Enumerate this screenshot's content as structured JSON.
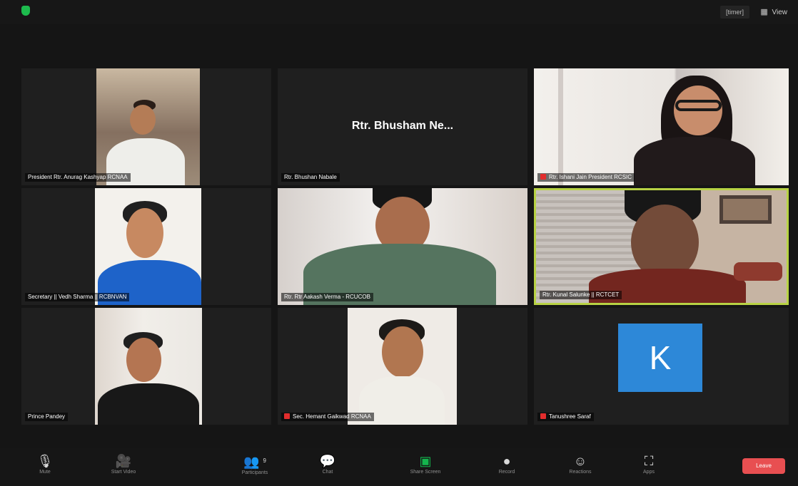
{
  "window": {
    "timer": "[timer]",
    "view_label": "View"
  },
  "participants": [
    {
      "name": "President Rtr. Anurag Kashyap RCNAA"
    },
    {
      "name": "Rtr. Bhushan Nabale",
      "display_name": "Rtr. Bhusham Ne..."
    },
    {
      "name": "Rtr. Ishani Jain President RCSIC"
    },
    {
      "name": "Secretary || Vedh Sharma || RCBNVAN"
    },
    {
      "name": "Rtr. Rtr Aakash Verma - RCUCOB"
    },
    {
      "name": "Rtr. Kunal Salunke || RCTCET"
    },
    {
      "name": "Prince Pandey"
    },
    {
      "name": "Sec. Hemant Gaikwad RCNAA"
    },
    {
      "name": "Tanushree Saraf",
      "avatar_letter": "K"
    }
  ],
  "toolbar": {
    "mute_label": "Mute",
    "video_label": "Start Video",
    "participants_label": "Participants",
    "participants_count": "9",
    "chat_label": "Chat",
    "share_label": "Share Screen",
    "record_label": "Record",
    "reactions_label": "Reactions",
    "apps_label": "Apps",
    "leave_label": "Leave"
  },
  "colors": {
    "active_speaker": "#b8d244",
    "avatar": "#2d88d8",
    "share_button": "#14b64d",
    "leave_button": "#e84f51",
    "muted": "#e22d2d"
  }
}
